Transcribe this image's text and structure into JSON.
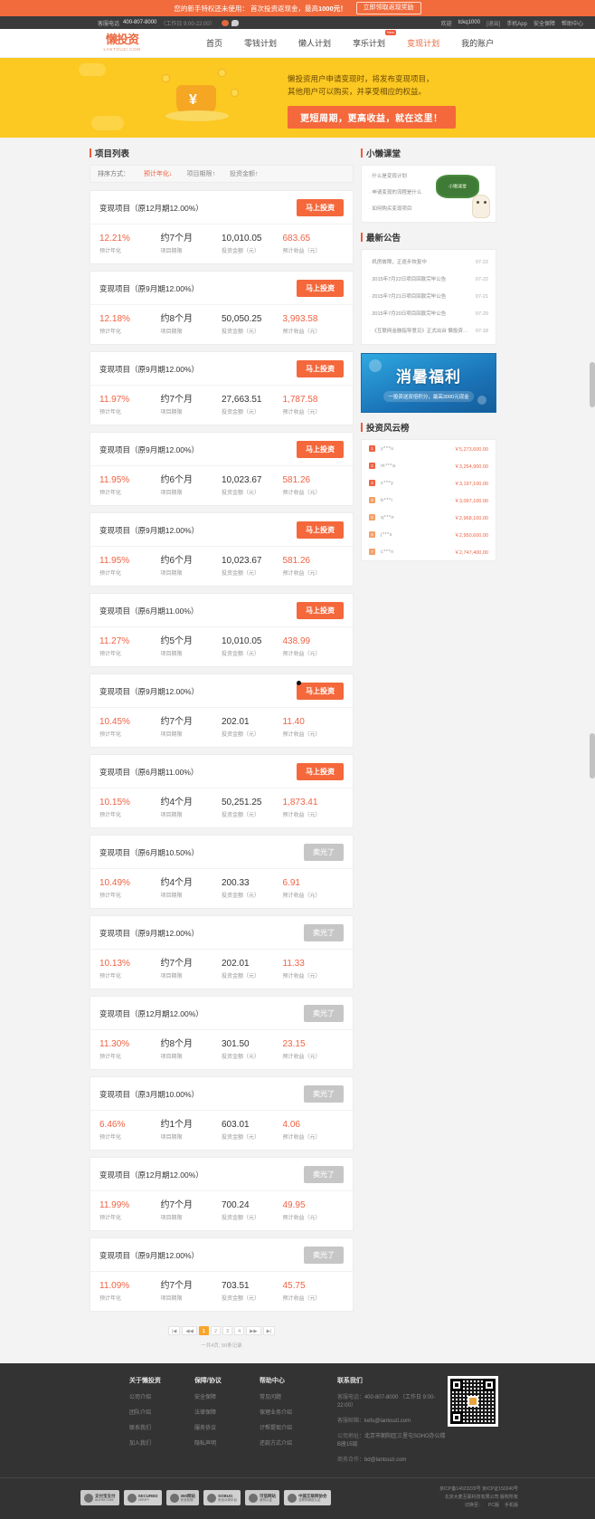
{
  "promo": {
    "text_prefix": "您的新手特权还未使用：",
    "text_main": "首次投资返现金，最高",
    "highlight": "1000元！",
    "button": "立即领取返现奖励"
  },
  "utility": {
    "phone_label": "客服电话",
    "phone": "400-807-8000",
    "hours": "（工作日 9:00-22:00）",
    "weibo_icon": "weibo-icon",
    "wechat_icon": "wechat-icon",
    "welcome": "欢迎",
    "username": "tckq1000",
    "logout": "[退出]",
    "app": "手机App",
    "security": "安全保障",
    "help": "帮助中心"
  },
  "header": {
    "logo_text": "懒投资",
    "logo_sub": "LANTOUZI.COM",
    "nav": [
      {
        "label": "首页",
        "active": false,
        "badge": ""
      },
      {
        "label": "零钱计划",
        "active": false,
        "badge": ""
      },
      {
        "label": "懒人计划",
        "active": false,
        "badge": ""
      },
      {
        "label": "享乐计划",
        "active": false,
        "badge": "New"
      },
      {
        "label": "变现计划",
        "active": true,
        "badge": ""
      },
      {
        "label": "我的账户",
        "active": false,
        "badge": ""
      }
    ]
  },
  "hero": {
    "line1": "懒投资用户申请变现时，将发布变现项目，",
    "line2": "其他用户可以购买，并享受相应的权益。",
    "cta": "更短周期，更高收益，就在这里！"
  },
  "project_list": {
    "title": "项目列表",
    "sort_label": "排序方式：",
    "sort_options": [
      {
        "label": "预计年化↓",
        "active": true
      },
      {
        "label": "项目期限↑",
        "active": false
      },
      {
        "label": "投资金额↑",
        "active": false
      }
    ],
    "labels": {
      "rate": "预计年化",
      "term": "项目期限",
      "amount": "投资金额（元）",
      "profit": "预计收益（元）"
    },
    "buy_label": "马上投资",
    "sold_label": "卖光了",
    "items": [
      {
        "title": "变现项目（原12月期12.00%）",
        "rate": "12.21%",
        "term": "约7个月",
        "amount": "10,010.05",
        "profit": "683.65",
        "sold": false
      },
      {
        "title": "变现项目（原9月期12.00%）",
        "rate": "12.18%",
        "term": "约8个月",
        "amount": "50,050.25",
        "profit": "3,993.58",
        "sold": false
      },
      {
        "title": "变现项目（原9月期12.00%）",
        "rate": "11.97%",
        "term": "约7个月",
        "amount": "27,663.51",
        "profit": "1,787.58",
        "sold": false
      },
      {
        "title": "变现项目（原9月期12.00%）",
        "rate": "11.95%",
        "term": "约6个月",
        "amount": "10,023.67",
        "profit": "581.26",
        "sold": false
      },
      {
        "title": "变现项目（原9月期12.00%）",
        "rate": "11.95%",
        "term": "约6个月",
        "amount": "10,023.67",
        "profit": "581.26",
        "sold": false
      },
      {
        "title": "变现项目（原6月期11.00%）",
        "rate": "11.27%",
        "term": "约5个月",
        "amount": "10,010.05",
        "profit": "438.99",
        "sold": false
      },
      {
        "title": "变现项目（原9月期12.00%）",
        "rate": "10.45%",
        "term": "约7个月",
        "amount": "202.01",
        "profit": "11.40",
        "sold": false
      },
      {
        "title": "变现项目（原6月期11.00%）",
        "rate": "10.15%",
        "term": "约4个月",
        "amount": "50,251.25",
        "profit": "1,873.41",
        "sold": false
      },
      {
        "title": "变现项目（原6月期10.50%）",
        "rate": "10.49%",
        "term": "约4个月",
        "amount": "200.33",
        "profit": "6.91",
        "sold": true
      },
      {
        "title": "变现项目（原9月期12.00%）",
        "rate": "10.13%",
        "term": "约7个月",
        "amount": "202.01",
        "profit": "11.33",
        "sold": true
      },
      {
        "title": "变现项目（原12月期12.00%）",
        "rate": "11.30%",
        "term": "约8个月",
        "amount": "301.50",
        "profit": "23.15",
        "sold": true
      },
      {
        "title": "变现项目（原3月期10.00%）",
        "rate": "6.46%",
        "term": "约1个月",
        "amount": "603.01",
        "profit": "4.06",
        "sold": true
      },
      {
        "title": "变现项目（原12月期12.00%）",
        "rate": "11.99%",
        "term": "约7个月",
        "amount": "700.24",
        "profit": "49.95",
        "sold": true
      },
      {
        "title": "变现项目（原9月期12.00%）",
        "rate": "11.09%",
        "term": "约7个月",
        "amount": "703.51",
        "profit": "45.75",
        "sold": true
      }
    ]
  },
  "pagination": {
    "first": "|◀",
    "prev": "◀◀",
    "pages": [
      "1",
      "2",
      "3",
      "4"
    ],
    "current": "1",
    "next": "▶▶",
    "last": "▶|",
    "info": "一共4页, 50条记录"
  },
  "sidebar": {
    "class_title": "小懒课堂",
    "class_links": [
      "什么是变现计划",
      "申请变现的流程是什么",
      "如何购买变现项目"
    ],
    "blackboard_text": "小懒课堂",
    "notice_title": "最新公告",
    "notices": [
      {
        "text": "机房故障，正逐步恢复中",
        "date": "07-22"
      },
      {
        "text": "2015年7月22日项目回款完毕公告",
        "date": "07-22"
      },
      {
        "text": "2015年7月21日项目回款完毕公告",
        "date": "07-21"
      },
      {
        "text": "2015年7月20日项目回款完毕公告",
        "date": "07-20"
      },
      {
        "text": "《互联网金融指导意见》正式出台 懒投资将...",
        "date": "07-18"
      }
    ],
    "ad_title": "消暑福利",
    "ad_sub": "一投资送双倍积分，最高3000元现金",
    "rank_title": "投资风云榜",
    "ranks": [
      {
        "no": "1",
        "user": "y***u",
        "amount": "￥5,273,600.00"
      },
      {
        "no": "2",
        "user": "m***a",
        "amount": "￥3,254,900.00"
      },
      {
        "no": "3",
        "user": "x***y",
        "amount": "￥3,197,100.00"
      },
      {
        "no": "4",
        "user": "b***i",
        "amount": "￥3,097,100.00"
      },
      {
        "no": "5",
        "user": "q***n",
        "amount": "￥2,968,100.00"
      },
      {
        "no": "6",
        "user": "j***s",
        "amount": "￥2,950,600.00"
      },
      {
        "no": "7",
        "user": "c***n",
        "amount": "￥2,747,400.00"
      }
    ]
  },
  "footer": {
    "columns": [
      {
        "title": "关于懒投资",
        "links": [
          "公司介绍",
          "团队介绍",
          "联系我们",
          "加入我们"
        ]
      },
      {
        "title": "保障/协议",
        "links": [
          "安全保障",
          "法律保障",
          "服务协议",
          "隐私声明"
        ]
      },
      {
        "title": "帮助中心",
        "links": [
          "常见问题",
          "保理业务介绍",
          "计帮提现介绍",
          "还款方式介绍"
        ]
      }
    ],
    "contact_title": "联系我们",
    "contact": [
      {
        "k": "客服电话：",
        "v": "400-807-8000  （工作日 9:00-22:00）"
      },
      {
        "k": "客服邮箱：",
        "v": "kefu@lantouzi.com"
      },
      {
        "k": "公司地址：",
        "v": "北京市朝阳区三里屯SOHO办公楼B座15层"
      },
      {
        "k": "商务合作：",
        "v": "bd@lantouzi.com"
      }
    ],
    "badges": [
      {
        "name": "支付宝支付",
        "sub": "ALIPAY.COM"
      },
      {
        "name": "SECURED",
        "sub": "VERIFY"
      },
      {
        "name": "360网站",
        "sub": "安全检测"
      },
      {
        "name": "SOBUG",
        "sub": "安全众测平台"
      },
      {
        "name": "可信网站",
        "sub": "身份认证"
      },
      {
        "name": "中国互联网协会",
        "sub": "互联网诚信认证"
      }
    ],
    "icp_line1": "京ICP备14023229号 京ICP证150240号",
    "icp_line2": "北京大麦互联科技有限公司 版权所有",
    "icp_links": [
      "切换至：",
      "PC版",
      "手机版"
    ]
  }
}
